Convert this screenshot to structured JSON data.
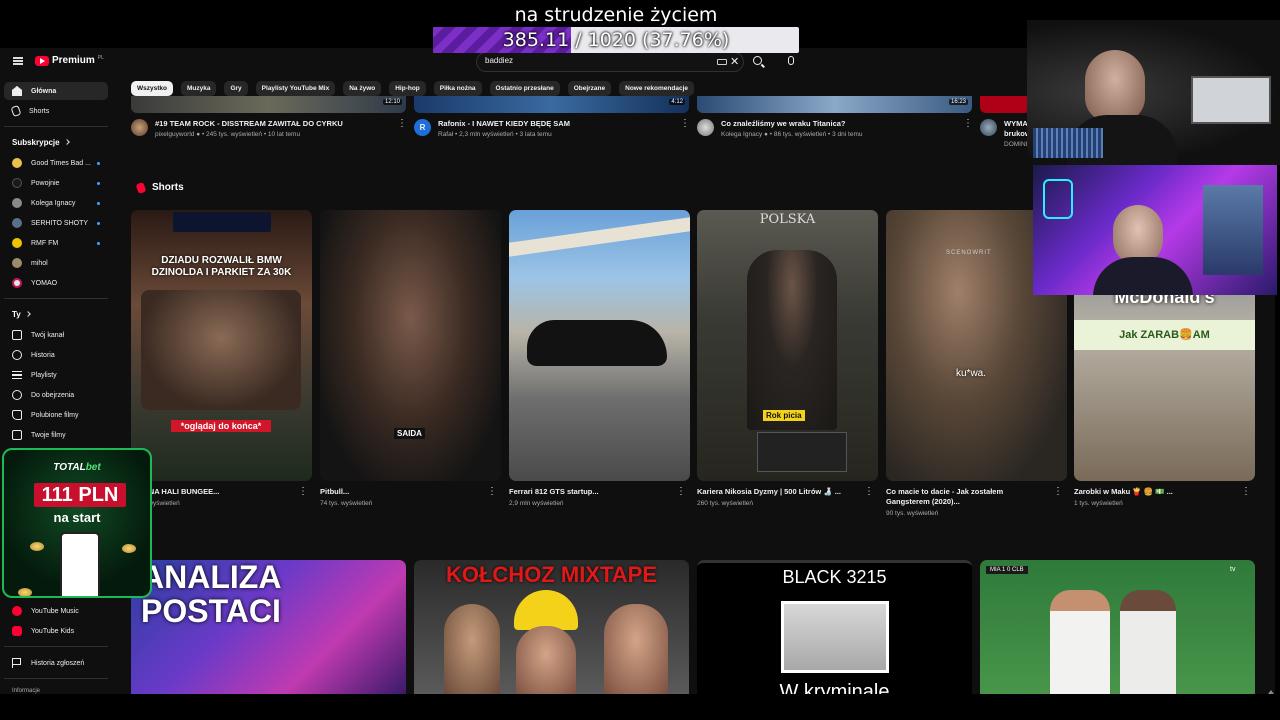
{
  "overlay": {
    "title": "na strudzenie życiem",
    "progress_current": "385.11",
    "progress_rest": " / 1020 (37.76%)",
    "progress_fraction": 0.3776
  },
  "youtube": {
    "logo": "Premium",
    "logo_sup": "PL",
    "search": {
      "value": "baddiez"
    },
    "icons": {
      "menu": "menu-icon",
      "search": "search-icon",
      "mic": "mic-icon",
      "clear": "close-icon",
      "keyboard": "keyboard-icon"
    }
  },
  "sidebar": {
    "main": [
      {
        "label": "Główna",
        "icon": "home-icon",
        "active": true
      },
      {
        "label": "Shorts",
        "icon": "shorts-icon",
        "active": false
      }
    ],
    "subscriptions_title": "Subskrypcje",
    "subscriptions": [
      {
        "label": "Good Times Bad ...",
        "color": "#e8c24a"
      },
      {
        "label": "Powojnie",
        "color": "#222222"
      },
      {
        "label": "Kolega Ignacy",
        "color": "#8a8a8a"
      },
      {
        "label": "SERHITO SHOTY",
        "color": "#5a6f8a"
      },
      {
        "label": "RMF FM",
        "color": "#f2c300"
      },
      {
        "label": "mihol",
        "color": "#9a8d6a"
      },
      {
        "label": "YOMAO",
        "color": "#e3e3e3"
      }
    ],
    "you_title": "Ty",
    "you": [
      {
        "label": "Twój kanał",
        "icon": "account-box-icon"
      },
      {
        "label": "Historia",
        "icon": "history-icon"
      },
      {
        "label": "Playlisty",
        "icon": "playlist-icon"
      },
      {
        "label": "Do obejrzenia",
        "icon": "watch-later-icon"
      },
      {
        "label": "Polubione filmy",
        "icon": "thumbs-up-icon"
      },
      {
        "label": "Twoje filmy",
        "icon": "your-videos-icon"
      }
    ],
    "more": [
      {
        "label": "YouTube Music",
        "icon": "youtube-music-icon"
      },
      {
        "label": "YouTube Kids",
        "icon": "youtube-kids-icon"
      }
    ],
    "report": "Historia zgłoszeń",
    "footer": "Informacje"
  },
  "chips": [
    "Wszystko",
    "Muzyka",
    "Gry",
    "Playlisty YouTube Mix",
    "Na żywo",
    "Hip-hop",
    "Piłka nożna",
    "Ostatnio przesłane",
    "Obejrzane",
    "Nowe rekomendacje"
  ],
  "top_videos": [
    {
      "duration": "12:10",
      "title": "#19 TEAM ROCK - DISSTREAM ZAWITAŁ DO CYRKU",
      "channel": "pixelguyworld",
      "views": "245 tys.",
      "age": "10 lat temu"
    },
    {
      "duration": "4:12",
      "title": "Rafonix - I NAWET KIEDY BĘDĘ SAM",
      "channel": "Rafał",
      "views": "2,3 mln",
      "age": "3 lata temu",
      "avatar_letter": "R"
    },
    {
      "duration": "16:23",
      "title": "Co znaleźliśmy we wraku Titanica?",
      "channel": "Kolega Ignacy",
      "views": "86 tys.",
      "age": "3 dni temu"
    },
    {
      "title": "WYMA",
      "title2": "brukow",
      "channel": "DOMINI"
    }
  ],
  "shorts": {
    "title": "Shorts",
    "items": [
      {
        "title": "...TY NA HALI BUNGEE...",
        "views": "2 tys. wyświetleń",
        "cap_top": "DZIADU ROZWALIŁ BMW\nDZINOLDA I PARKIET ZA 30K",
        "cap_bottom": "*oglądaj do końca*"
      },
      {
        "title": "Pitbull...",
        "views": "74 tys. wyświetleń",
        "cap_bottom": "SAIDA"
      },
      {
        "title": "Ferrari 812 GTS startup...",
        "views": "2,9 mln wyświetleń"
      },
      {
        "title": "Kariera Nikosia Dyzmy | 500 Litrów 🍶 ...",
        "views": "260 tys. wyświetleń",
        "cap_top": "POLSKA",
        "cap_bottom": "Rok picia"
      },
      {
        "title": "Co macie to dacie - Jak zostałem Gangsterem (2020)...",
        "views": "90 tys. wyświetleń",
        "cap_top": "SCENOWRIT",
        "cap_bottom": "ku*wa."
      },
      {
        "title": "Zarobki w Maku 🍟 🍔 💵 ...",
        "views": "1 tys. wyświetleń",
        "cap_top": "Pracuje w McDonald's",
        "cap_bottom": "Jak ZARAB🍔AM"
      }
    ]
  },
  "bottom_videos": [
    {
      "text": "ANALIZA\nPOSTACI"
    },
    {
      "text": "KOŁCHOZ MIXTAPE"
    },
    {
      "text": "BLACK 3215",
      "text2": "W kryminale"
    },
    {
      "text": "MIA 1 0 CLB",
      "text2": "tv"
    }
  ],
  "ad": {
    "brand_a": "TOTAL",
    "brand_b": "bet",
    "amount": "111 PLN",
    "sub": "na start"
  }
}
